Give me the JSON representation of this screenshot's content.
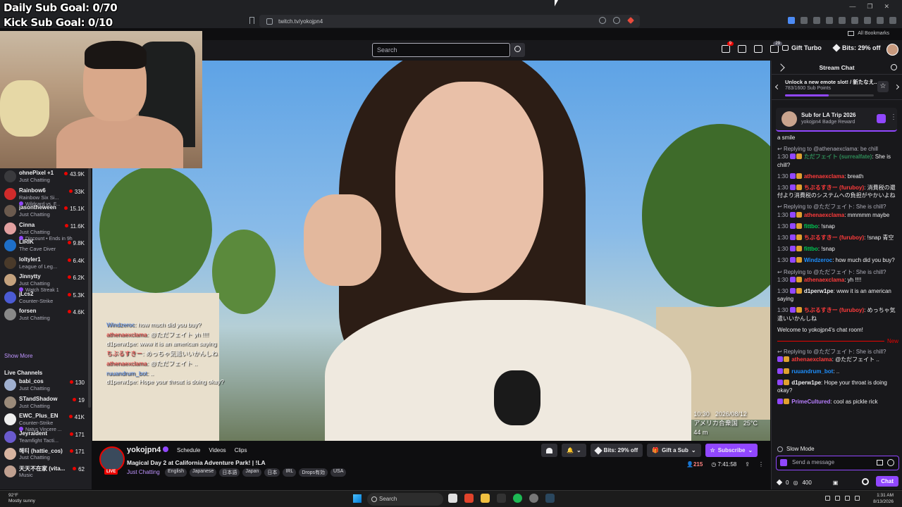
{
  "overlay": {
    "daily_goal": "Daily Sub Goal: 0/70",
    "kick_goal": "Kick Sub Goal: 0/10"
  },
  "browser": {
    "url": "twitch.tv/yokojpn4",
    "all_bookmarks": "All Bookmarks"
  },
  "nav": {
    "search_placeholder": "Search",
    "notif_badge": "9",
    "prime_badge": "29",
    "gift_turbo": "Gift Turbo",
    "bits_off": "Bits: 29% off"
  },
  "sidebar": {
    "followed": [
      {
        "name": "ohnePixel +1",
        "category": "Just Chatting",
        "viewers": "43.9K",
        "color": "#3a3a3d"
      },
      {
        "name": "Rainbow6",
        "category": "Rainbow Six Si...",
        "extra": "Wildcard vs. F...",
        "viewers": "33K",
        "color": "#d02b2b"
      },
      {
        "name": "jasontheween",
        "category": "Just Chatting",
        "viewers": "15.1K",
        "color": "#6b5a4e"
      },
      {
        "name": "Cinna",
        "category": "Just Chatting",
        "extra": "Discount • Ends in 9h",
        "viewers": "11.6K",
        "color": "#e2a0a0"
      },
      {
        "name": "LIRIK",
        "category": "The Cave Diver",
        "viewers": "9.8K",
        "color": "#1e6fc8"
      },
      {
        "name": "loltyler1",
        "category": "League of Leg...",
        "viewers": "6.4K",
        "color": "#4a3a2a"
      },
      {
        "name": "Jinnytty",
        "category": "Just Chatting",
        "extra": "Watch Streak 1",
        "viewers": "6.2K",
        "color": "#c4a27e"
      },
      {
        "name": "jLcs2",
        "category": "Counter-Strike",
        "viewers": "5.3K",
        "color": "#4b5bd4"
      },
      {
        "name": "forsen",
        "category": "Just Chatting",
        "viewers": "4.6K",
        "color": "#888888"
      }
    ],
    "show_more": "Show More",
    "live_channels_title": "Live Channels",
    "live": [
      {
        "name": "babi_cos",
        "category": "Just Chatting",
        "viewers": "130",
        "color": "#a0b0d0"
      },
      {
        "name": "STandShadow",
        "category": "Just Chatting",
        "viewers": "19",
        "color": "#9a8a7a"
      },
      {
        "name": "EWC_Plus_EN",
        "category": "Counter-Strike",
        "extra": "Natus Vincere ...",
        "viewers": "41K",
        "color": "#eeeeee"
      },
      {
        "name": "Jeyraident",
        "category": "Teamfight Tacti...",
        "viewers": "171",
        "color": "#6a5acd"
      },
      {
        "name": "해티 (hattie_cos)",
        "category": "Just Chatting",
        "viewers": "171",
        "color": "#d8b4a0"
      },
      {
        "name": "天天不在家 (vita...",
        "category": "Music",
        "viewers": "62",
        "color": "#c0a090"
      }
    ]
  },
  "video": {
    "overlay_chat": [
      {
        "name": "Windzeroc",
        "text": "how much did you buy?",
        "cls": "nm-blue"
      },
      {
        "name": "athenaexclama",
        "text": "@ただフェイト yh !!!!",
        "cls": "nm-red"
      },
      {
        "name": "d1perw1pe",
        "text": "www it is an american saying",
        "cls": "nm-white"
      },
      {
        "name": "ちぶるすきー",
        "text": "めっちゃ気遣いいかんしね",
        "cls": "nm-red"
      },
      {
        "name": "athenaexclama",
        "text": "@ただフェイト ..",
        "cls": "nm-red"
      },
      {
        "name": "ruuandrum_bot",
        "text": "..",
        "cls": "nm-blue"
      },
      {
        "name": "d1perw1pe",
        "text": "Hope your throat is doing okay?",
        "cls": "nm-white"
      }
    ],
    "time": "10:30",
    "date": "2026/08/12",
    "location": "アメリカ合衆国",
    "temp": "25°C",
    "distance": "44 m"
  },
  "channel": {
    "name": "yokojpn4",
    "live": "LIVE",
    "tabs": [
      "Schedule",
      "Videos",
      "Clips"
    ],
    "title": "Magical Day 2 at California Adventure Park! | !LA",
    "category": "Just Chatting",
    "tags": [
      "English",
      "Japanese",
      "日本語",
      "Japan",
      "日本",
      "IRL",
      "Drops有効",
      "USA"
    ],
    "bits_off": "Bits: 29% off",
    "gift_sub": "Gift a Sub",
    "subscribe": "Subscribe",
    "viewers": "215",
    "uptime": "7:41:58"
  },
  "chat": {
    "title": "Stream Chat",
    "unlock_title": "Unlock a new emote slot! / 新たなえ...",
    "unlock_sub": "783/1600 Sub Points",
    "unlock_progress": 0.49,
    "pinned_title": "Sub for LA Trip 2026",
    "pinned_sub": "yokojpn4 Badge Reward",
    "messages": [
      {
        "type": "plain",
        "text": "a smile"
      },
      {
        "type": "reply",
        "reply": "Replying to @athenaexclama: be chill",
        "time": "1:30",
        "name": "ただフェイト (surrealfate)",
        "color": "#2e8b57",
        "text": "She is chill?"
      },
      {
        "type": "msg",
        "time": "1:30",
        "name": "athenaexclama",
        "color": "#ff3b3b",
        "text": "breath"
      },
      {
        "type": "msg",
        "time": "1:30",
        "name": "ちぶるすきー (furuboy)",
        "color": "#ff3b3b",
        "text": "消費税の還付より消費税のシステムへの負担がやかいよね"
      },
      {
        "type": "reply",
        "reply": "Replying to @ただフェイト: She is chill?",
        "time": "1:30",
        "name": "athenaexclama",
        "color": "#ff3b3b",
        "text": "mmmmm maybe"
      },
      {
        "type": "msg",
        "time": "1:30",
        "name": "fittbo",
        "color": "#00c853",
        "text": "!snap"
      },
      {
        "type": "msg",
        "time": "1:30",
        "name": "ちぶるすきー (furuboy)",
        "color": "#ff3b3b",
        "text": "!snap 青空"
      },
      {
        "type": "msg",
        "time": "1:30",
        "name": "fittbo",
        "color": "#00c853",
        "text": "!snap"
      },
      {
        "type": "msg",
        "time": "1:30",
        "name": "Windzeroc",
        "color": "#1e90ff",
        "text": "how much did you buy?"
      },
      {
        "type": "reply",
        "reply": "Replying to @ただフェイト: She is chill?",
        "time": "1:30",
        "name": "athenaexclama",
        "color": "#ff3b3b",
        "text": "yh !!!!"
      },
      {
        "type": "msg",
        "time": "1:30",
        "name": "d1perw1pe",
        "color": "#efeff1",
        "text": "www it is an american saying"
      },
      {
        "type": "msg",
        "time": "1:30",
        "name": "ちぶるすきー (furuboy)",
        "color": "#ff3b3b",
        "text": "めっちゃ気遣いいかんしね"
      },
      {
        "type": "plain",
        "text": "Welcome to yokojpn4's chat room!"
      },
      {
        "type": "divider",
        "text": "New"
      },
      {
        "type": "reply",
        "reply": "Replying to @ただフェイト: She is chill?",
        "time": "",
        "name": "athenaexclama",
        "color": "#ff3b3b",
        "text": "@ただフェイト .."
      },
      {
        "type": "msg",
        "time": "",
        "name": "ruuandrum_bot",
        "color": "#1e90ff",
        "text": ".."
      },
      {
        "type": "msg",
        "time": "",
        "name": "d1perw1pe",
        "color": "#efeff1",
        "text": "Hope your throat is doing okay?"
      },
      {
        "type": "msg",
        "time": "",
        "name": "PrimeCultured",
        "color": "#b87fff",
        "text": "cool as pickle rick"
      }
    ],
    "slow_mode": "Slow Mode",
    "input_placeholder": "Send a message",
    "bits_balance": "0",
    "points": "400",
    "chat_button": "Chat"
  },
  "taskbar": {
    "weather_temp": "92°F",
    "weather_desc": "Mostly sunny",
    "search": "Search",
    "time": "1:31 AM",
    "date": "8/13/2026"
  }
}
